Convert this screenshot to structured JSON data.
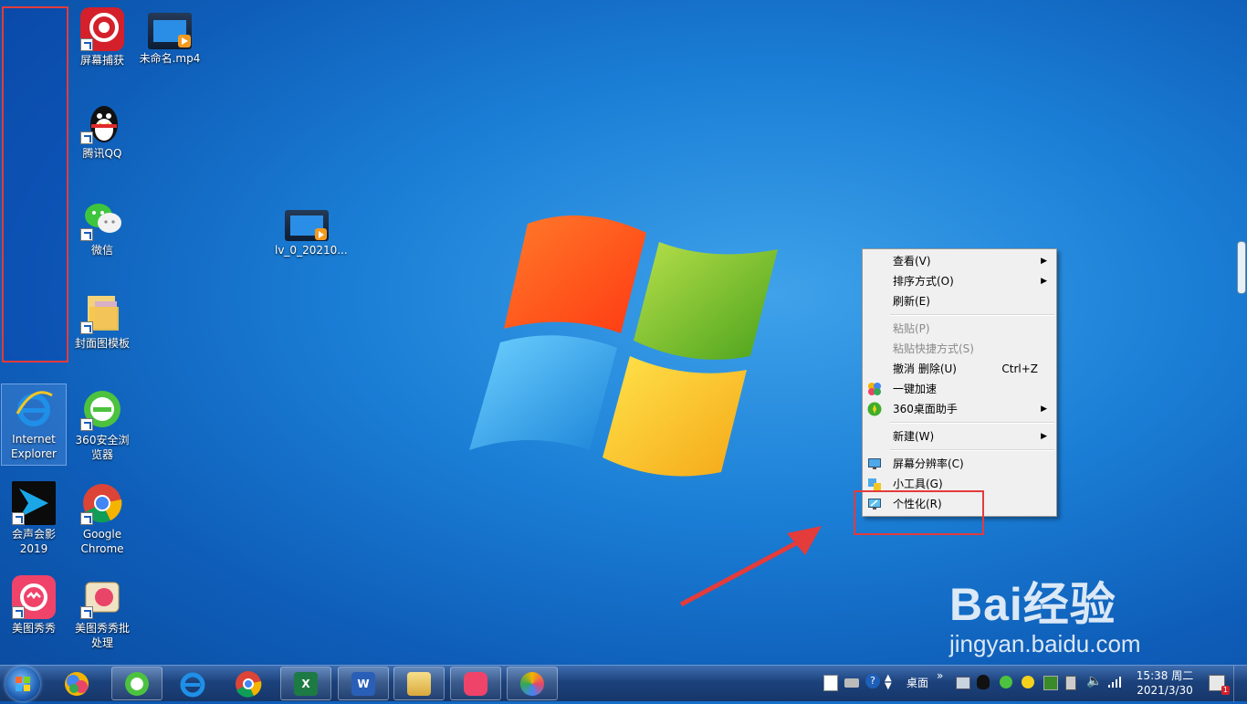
{
  "desktop": {
    "icons": [
      {
        "label": "屏幕捕获"
      },
      {
        "label": "未命名.mp4"
      },
      {
        "label": "腾讯QQ"
      },
      {
        "label": "微信"
      },
      {
        "label": "lv_0_20210..."
      },
      {
        "label": "封面图模板"
      },
      {
        "label": "Internet Explorer"
      },
      {
        "label": "360安全浏览器"
      },
      {
        "label": "会声会影2019"
      },
      {
        "label": "Google Chrome"
      },
      {
        "label": "美图秀秀"
      },
      {
        "label": "美图秀秀批处理"
      }
    ]
  },
  "context_menu": {
    "items": [
      {
        "label": "查看(V)",
        "submenu": true
      },
      {
        "label": "排序方式(O)",
        "submenu": true
      },
      {
        "label": "刷新(E)"
      },
      {
        "label": "粘贴(P)",
        "disabled": true
      },
      {
        "label": "粘贴快捷方式(S)",
        "disabled": true
      },
      {
        "label": "撤消 删除(U)",
        "shortcut": "Ctrl+Z"
      },
      {
        "label": "一键加速"
      },
      {
        "label": "360桌面助手",
        "submenu": true
      },
      {
        "label": "新建(W)",
        "submenu": true
      },
      {
        "label": "屏幕分辨率(C)"
      },
      {
        "label": "小工具(G)"
      },
      {
        "label": "个性化(R)"
      }
    ]
  },
  "taskbar": {
    "apps": [
      "360-icon",
      "ie-icon",
      "chrome-icon",
      "excel-icon",
      "word-icon",
      "explorer-icon",
      "meitu-icon",
      "photo-icon"
    ],
    "desktop_toolbar": "桌面",
    "tray_expand": "»",
    "clock_time": "15:38 周二",
    "clock_date": "2021/3/30",
    "notification_count": "1"
  },
  "watermark": {
    "brand": "Bai经验",
    "url": "jingyan.baidu.com"
  },
  "colors": {
    "annotation_red": "#e43b3b",
    "menu_bg": "#f0f0f0"
  }
}
